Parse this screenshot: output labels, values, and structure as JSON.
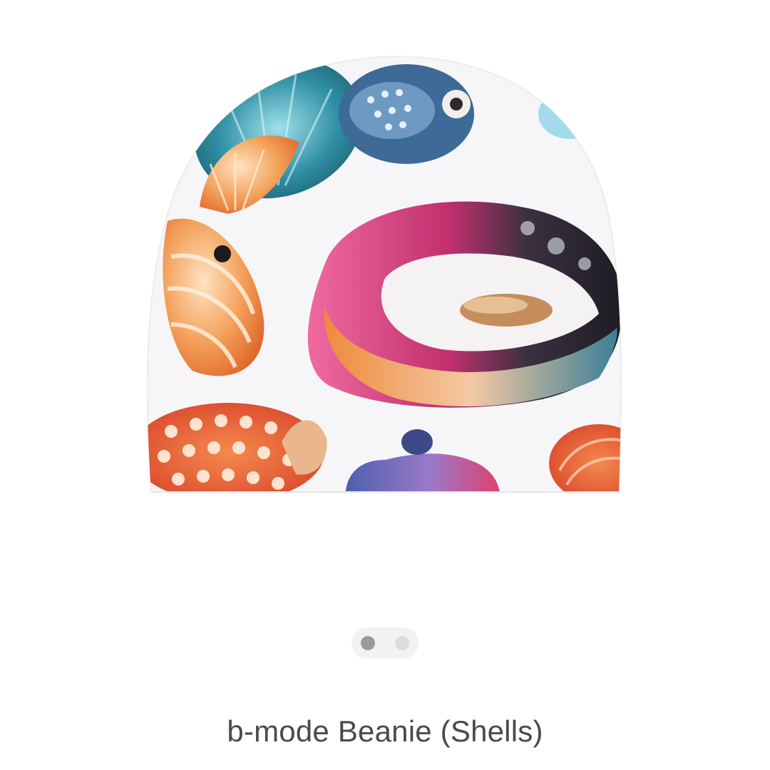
{
  "product": {
    "title": "b-mode Beanie (Shells)",
    "image_alt": "beanie with shell print"
  },
  "gallery": {
    "slide_count": 2,
    "active_slide": 1
  },
  "colors": {
    "text": "#4a4a4a",
    "pager_bg": "#f2f2f2",
    "dot_active": "#9a9a9a",
    "dot_inactive": "#dcdcdc"
  }
}
